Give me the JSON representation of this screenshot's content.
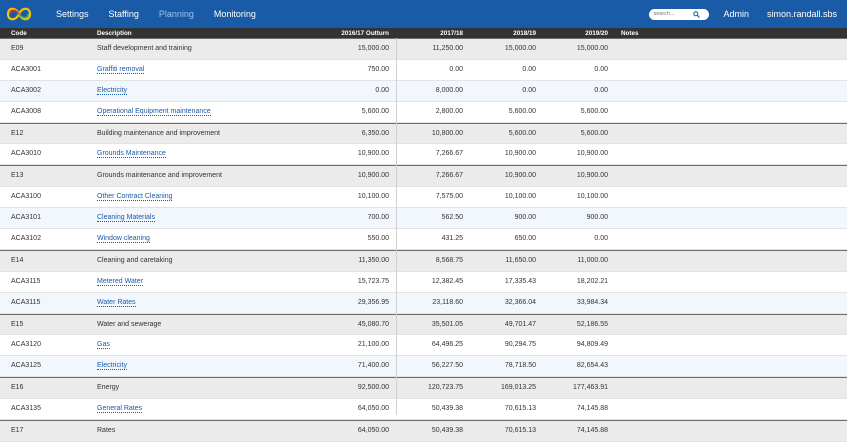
{
  "nav": {
    "items": [
      {
        "label": "Settings",
        "active": false
      },
      {
        "label": "Staffing",
        "active": false
      },
      {
        "label": "Planning",
        "active": true
      },
      {
        "label": "Monitoring",
        "active": false
      }
    ],
    "search_placeholder": "search...",
    "admin_label": "Admin",
    "user_label": "simon.randall.sbs"
  },
  "table": {
    "headers": {
      "code": "Code",
      "description": "Description",
      "y1": "2016/17 Outturn",
      "y2": "2017/18",
      "y3": "2018/19",
      "y4": "2019/20",
      "notes": "Notes"
    },
    "rows": [
      {
        "code": "E09",
        "description": "Staff development and training",
        "y1": "15,000.00",
        "y2": "11,250.00",
        "y3": "15,000.00",
        "y4": "15,000.00",
        "type": "group"
      },
      {
        "code": "ACA3001",
        "description": "Graffiti removal",
        "y1": "750.00",
        "y2": "0.00",
        "y3": "0.00",
        "y4": "0.00",
        "type": "item"
      },
      {
        "code": "ACA3002",
        "description": "Electricity",
        "y1": "0.00",
        "y2": "8,000.00",
        "y3": "0.00",
        "y4": "0.00",
        "type": "item"
      },
      {
        "code": "ACA3008",
        "description": "Operational Equipment maintenance",
        "y1": "5,600.00",
        "y2": "2,800.00",
        "y3": "5,600.00",
        "y4": "5,600.00",
        "type": "item"
      },
      {
        "code": "E12",
        "description": "Building maintenance and improvement",
        "y1": "6,350.00",
        "y2": "10,800.00",
        "y3": "5,600.00",
        "y4": "5,600.00",
        "type": "group"
      },
      {
        "code": "ACA3010",
        "description": "Grounds Maintenance",
        "y1": "10,900.00",
        "y2": "7,266.67",
        "y3": "10,900.00",
        "y4": "10,900.00",
        "type": "item"
      },
      {
        "code": "E13",
        "description": "Grounds maintenance and improvement",
        "y1": "10,900.00",
        "y2": "7,266.67",
        "y3": "10,900.00",
        "y4": "10,900.00",
        "type": "group"
      },
      {
        "code": "ACA3100",
        "description": "Other Contract Cleaning",
        "y1": "10,100.00",
        "y2": "7,575.00",
        "y3": "10,100.00",
        "y4": "10,100.00",
        "type": "item"
      },
      {
        "code": "ACA3101",
        "description": "Cleaning Materials",
        "y1": "700.00",
        "y2": "562.50",
        "y3": "900.00",
        "y4": "900.00",
        "type": "item"
      },
      {
        "code": "ACA3102",
        "description": "Window cleaning",
        "y1": "550.00",
        "y2": "431.25",
        "y3": "650.00",
        "y4": "0.00",
        "type": "item"
      },
      {
        "code": "E14",
        "description": "Cleaning and caretaking",
        "y1": "11,350.00",
        "y2": "8,568.75",
        "y3": "11,650.00",
        "y4": "11,000.00",
        "type": "group"
      },
      {
        "code": "ACA3115",
        "description": "Metered Water",
        "y1": "15,723.75",
        "y2": "12,382.45",
        "y3": "17,335.43",
        "y4": "18,202.21",
        "type": "item"
      },
      {
        "code": "ACA3115",
        "description": "Water Rates",
        "y1": "29,356.95",
        "y2": "23,118.60",
        "y3": "32,366.04",
        "y4": "33,984.34",
        "type": "item"
      },
      {
        "code": "E15",
        "description": "Water and sewerage",
        "y1": "45,080.70",
        "y2": "35,501.05",
        "y3": "49,701.47",
        "y4": "52,186.55",
        "type": "group"
      },
      {
        "code": "ACA3120",
        "description": "Gas",
        "y1": "21,100.00",
        "y2": "64,496.25",
        "y3": "90,294.75",
        "y4": "94,809.49",
        "type": "item"
      },
      {
        "code": "ACA3125",
        "description": "Electricity",
        "y1": "71,400.00",
        "y2": "56,227.50",
        "y3": "78,718.50",
        "y4": "82,654.43",
        "type": "item"
      },
      {
        "code": "E16",
        "description": "Energy",
        "y1": "92,500.00",
        "y2": "120,723.75",
        "y3": "169,013.25",
        "y4": "177,463.91",
        "type": "group"
      },
      {
        "code": "ACA3135",
        "description": "General Rates",
        "y1": "64,050.00",
        "y2": "50,439.38",
        "y3": "70,615.13",
        "y4": "74,145.88",
        "type": "item"
      },
      {
        "code": "E17",
        "description": "Rates",
        "y1": "64,050.00",
        "y2": "50,439.38",
        "y3": "70,615.13",
        "y4": "74,145.88",
        "type": "group"
      }
    ]
  }
}
